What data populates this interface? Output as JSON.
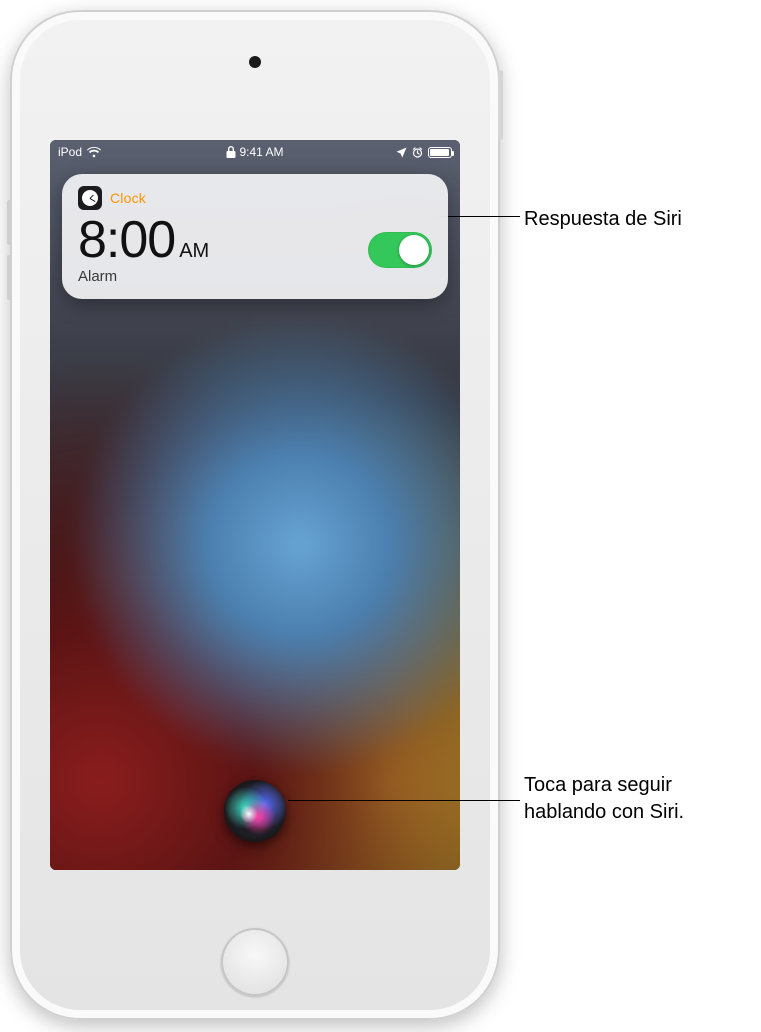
{
  "statusbar": {
    "device": "iPod",
    "time": "9:41 AM"
  },
  "card": {
    "app_name": "Clock",
    "time": "8:00",
    "ampm": "AM",
    "label": "Alarm",
    "toggle_on": true
  },
  "callouts": {
    "siri_response": "Respuesta de Siri",
    "tap_to_continue": "Toca para seguir\nhablando con Siri."
  }
}
